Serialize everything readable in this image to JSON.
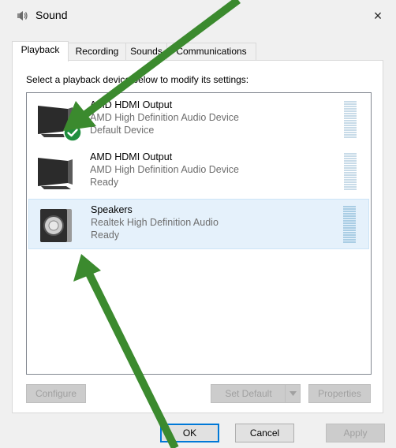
{
  "window": {
    "title": "Sound",
    "close_label": "×"
  },
  "tabs": [
    {
      "label": "Playback",
      "active": true
    },
    {
      "label": "Recording",
      "active": false
    },
    {
      "label": "Sounds",
      "active": false
    },
    {
      "label": "Communications",
      "active": false
    }
  ],
  "panel": {
    "instruction": "Select a playback device below to modify its settings:"
  },
  "devices": [
    {
      "name": "AMD HDMI Output",
      "description": "AMD High Definition Audio Device",
      "status": "Default Device",
      "icon": "monitor-icon",
      "is_default": true,
      "selected": false
    },
    {
      "name": "AMD HDMI Output",
      "description": "AMD High Definition Audio Device",
      "status": "Ready",
      "icon": "monitor-icon",
      "is_default": false,
      "selected": false
    },
    {
      "name": "Speakers",
      "description": "Realtek High Definition Audio",
      "status": "Ready",
      "icon": "speaker-icon",
      "is_default": false,
      "selected": true
    }
  ],
  "panel_buttons": {
    "configure": "Configure",
    "set_default": "Set Default",
    "properties": "Properties"
  },
  "dialog_buttons": {
    "ok": "OK",
    "cancel": "Cancel",
    "apply": "Apply"
  },
  "annotations": {
    "arrow_color": "#3b8a2e"
  },
  "colors": {
    "selection_bg": "#e5f1fb",
    "default_check": "#1e8e3e",
    "accent": "#0078d7"
  }
}
